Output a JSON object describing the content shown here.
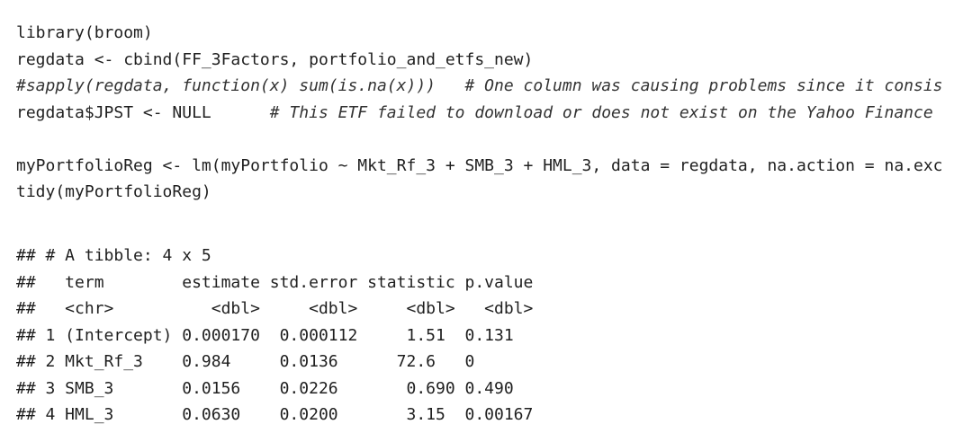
{
  "code": {
    "line1": "library(broom)",
    "line2": "regdata <- cbind(FF_3Factors, portfolio_and_etfs_new)",
    "line3_comment": "#sapply(regdata, function(x) sum(is.na(x)))   # One column was causing problems since it consis",
    "line4_code": "regdata$JPST <- NULL      ",
    "line4_comment": "# This ETF failed to download or does not exist on the Yahoo Finance",
    "line5": "myPortfolioReg <- lm(myPortfolio ~ Mkt_Rf_3 + SMB_3 + HML_3, data = regdata, na.action = na.exc",
    "line6": "tidy(myPortfolioReg)"
  },
  "output": {
    "header": "## # A tibble: 4 x 5",
    "columns": "##   term        estimate std.error statistic p.value",
    "types": "##   <chr>          <dbl>     <dbl>     <dbl>   <dbl>",
    "rows": [
      "## 1 (Intercept) 0.000170  0.000112     1.51  0.131",
      "## 2 Mkt_Rf_3    0.984     0.0136      72.6   0",
      "## 3 SMB_3       0.0156    0.0226       0.690 0.490",
      "## 4 HML_3       0.0630    0.0200       3.15  0.00167"
    ]
  }
}
